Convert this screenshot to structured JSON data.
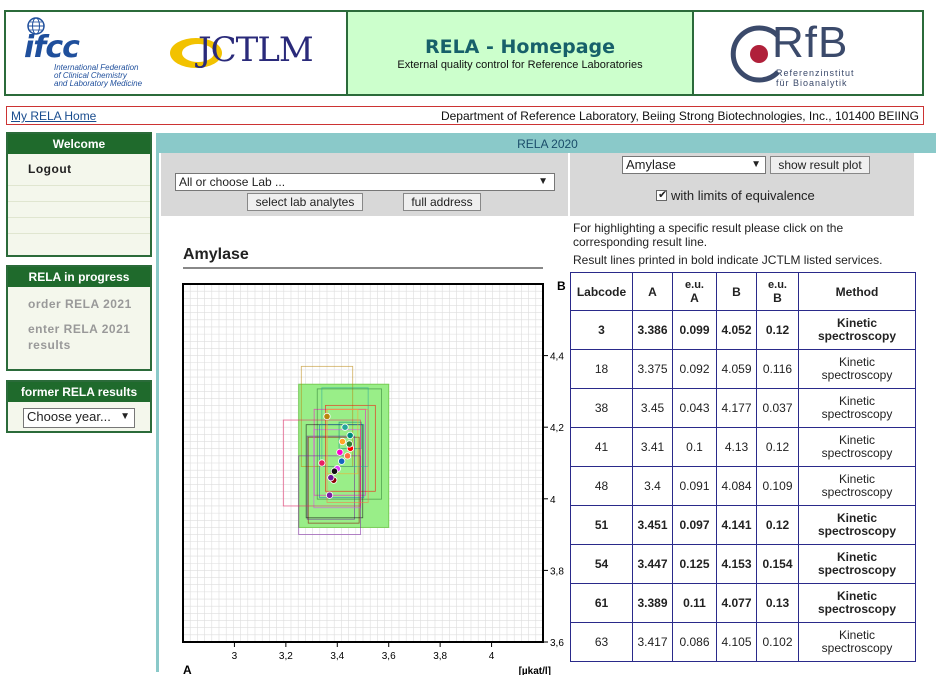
{
  "header": {
    "title": "RELA - Homepage",
    "subtitle": "External quality control for Reference Laboratories",
    "ifcc_logo_text": "ifcc",
    "ifcc_tagline": [
      "International Federation",
      "of Clinical Chemistry",
      "and Laboratory Medicine"
    ],
    "jctlm_logo_text": "JCTLM",
    "rfb_logo_text": "RfB",
    "rfb_tagline": [
      "Referenzinstitut",
      "für Bioanalytik"
    ]
  },
  "topbar": {
    "home_link": "My RELA Home",
    "department": "Department of Reference Laboratory, Beiing Strong Biotechnologies, Inc., 101400 BEIING"
  },
  "sidebar": {
    "welcome": {
      "title": "Welcome",
      "logout": "Logout"
    },
    "progress": {
      "title": "RELA in progress",
      "order": "order RELA 2021",
      "enter": "enter RELA 2021 results"
    },
    "former": {
      "title": "former RELA results",
      "select_value": "Choose year..."
    }
  },
  "main": {
    "heading": "RELA 2020",
    "lab_select": "All or choose Lab ...",
    "select_lab_analytes": "select lab analytes",
    "full_address": "full address",
    "analyte_select": "Amylase",
    "show_result_plot": "show result plot",
    "equivalence_label": "with limits of equivalence",
    "equivalence_checked": true,
    "note1": "For highlighting a specific result please click on the corresponding result line.",
    "note2": "Result lines printed in bold indicate JCTLM listed services."
  },
  "plot": {
    "title": "Amylase",
    "axis_a_label": "A",
    "axis_b_label": "B",
    "unit_label": "[µkat/l]",
    "x_ticks": [
      "3",
      "3,2",
      "3,4",
      "3,6",
      "3,8",
      "4"
    ],
    "y_ticks": [
      "4,4",
      "4,2",
      "4",
      "3,8",
      "3,6"
    ]
  },
  "table": {
    "headers": [
      "Labcode",
      "A",
      "e.u. A",
      "B",
      "e.u. B",
      "Method"
    ],
    "rows": [
      {
        "labcode": "3",
        "a": "3.386",
        "eua": "0.099",
        "b": "4.052",
        "eub": "0.12",
        "method": "Kinetic spectroscopy",
        "bold": true
      },
      {
        "labcode": "18",
        "a": "3.375",
        "eua": "0.092",
        "b": "4.059",
        "eub": "0.116",
        "method": "Kinetic spectroscopy",
        "bold": false
      },
      {
        "labcode": "38",
        "a": "3.45",
        "eua": "0.043",
        "b": "4.177",
        "eub": "0.037",
        "method": "Kinetic spectroscopy",
        "bold": false
      },
      {
        "labcode": "41",
        "a": "3.41",
        "eua": "0.1",
        "b": "4.13",
        "eub": "0.12",
        "method": "Kinetic spectroscopy",
        "bold": false
      },
      {
        "labcode": "48",
        "a": "3.4",
        "eua": "0.091",
        "b": "4.084",
        "eub": "0.109",
        "method": "Kinetic spectroscopy",
        "bold": false
      },
      {
        "labcode": "51",
        "a": "3.451",
        "eua": "0.097",
        "b": "4.141",
        "eub": "0.12",
        "method": "Kinetic spectroscopy",
        "bold": true
      },
      {
        "labcode": "54",
        "a": "3.447",
        "eua": "0.125",
        "b": "4.153",
        "eub": "0.154",
        "method": "Kinetic spectroscopy",
        "bold": true
      },
      {
        "labcode": "61",
        "a": "3.389",
        "eua": "0.11",
        "b": "4.077",
        "eub": "0.13",
        "method": "Kinetic spectroscopy",
        "bold": true
      },
      {
        "labcode": "63",
        "a": "3.417",
        "eua": "0.086",
        "b": "4.105",
        "eub": "0.102",
        "method": "Kinetic spectroscopy",
        "bold": false
      }
    ]
  },
  "chart_data": {
    "type": "scatter",
    "xlabel": "A",
    "ylabel": "B",
    "unit": "[µkat/l]",
    "xlim": [
      2.8,
      4.2
    ],
    "ylim": [
      3.6,
      4.6
    ],
    "equivalence_region": {
      "x": [
        3.25,
        3.6
      ],
      "y": [
        3.92,
        4.32
      ],
      "color": "#99ee88"
    },
    "points": [
      {
        "x": 3.36,
        "y": 4.23,
        "color": "#b8860b",
        "eua": 0.1,
        "eub": 0.14
      },
      {
        "x": 3.386,
        "y": 4.052,
        "color": "#8b0000",
        "eua": 0.099,
        "eub": 0.12
      },
      {
        "x": 3.375,
        "y": 4.059,
        "color": "#6a1b9a",
        "eua": 0.092,
        "eub": 0.116
      },
      {
        "x": 3.45,
        "y": 4.177,
        "color": "#00897b",
        "eua": 0.043,
        "eub": 0.037
      },
      {
        "x": 3.41,
        "y": 4.13,
        "color": "#ff00cc",
        "eua": 0.1,
        "eub": 0.12
      },
      {
        "x": 3.4,
        "y": 4.084,
        "color": "#e040fb",
        "eua": 0.091,
        "eub": 0.109
      },
      {
        "x": 3.451,
        "y": 4.141,
        "color": "#ff0000",
        "eua": 0.097,
        "eub": 0.12
      },
      {
        "x": 3.447,
        "y": 4.153,
        "color": "#2e7d32",
        "eua": 0.125,
        "eub": 0.154
      },
      {
        "x": 3.389,
        "y": 4.077,
        "color": "#111111",
        "eua": 0.11,
        "eub": 0.13
      },
      {
        "x": 3.417,
        "y": 4.105,
        "color": "#1565c0",
        "eua": 0.086,
        "eub": 0.102
      },
      {
        "x": 3.37,
        "y": 4.01,
        "color": "#7b1fa2",
        "eua": 0.12,
        "eub": 0.11
      },
      {
        "x": 3.43,
        "y": 4.2,
        "color": "#26a69a",
        "eua": 0.09,
        "eub": 0.11
      },
      {
        "x": 3.34,
        "y": 4.1,
        "color": "#e91e63",
        "eua": 0.15,
        "eub": 0.12
      },
      {
        "x": 3.44,
        "y": 4.12,
        "color": "#ff7043",
        "eua": 0.08,
        "eub": 0.13
      },
      {
        "x": 3.42,
        "y": 4.16,
        "color": "#ffa726",
        "eua": 0.06,
        "eub": 0.09
      }
    ],
    "grid": true
  }
}
